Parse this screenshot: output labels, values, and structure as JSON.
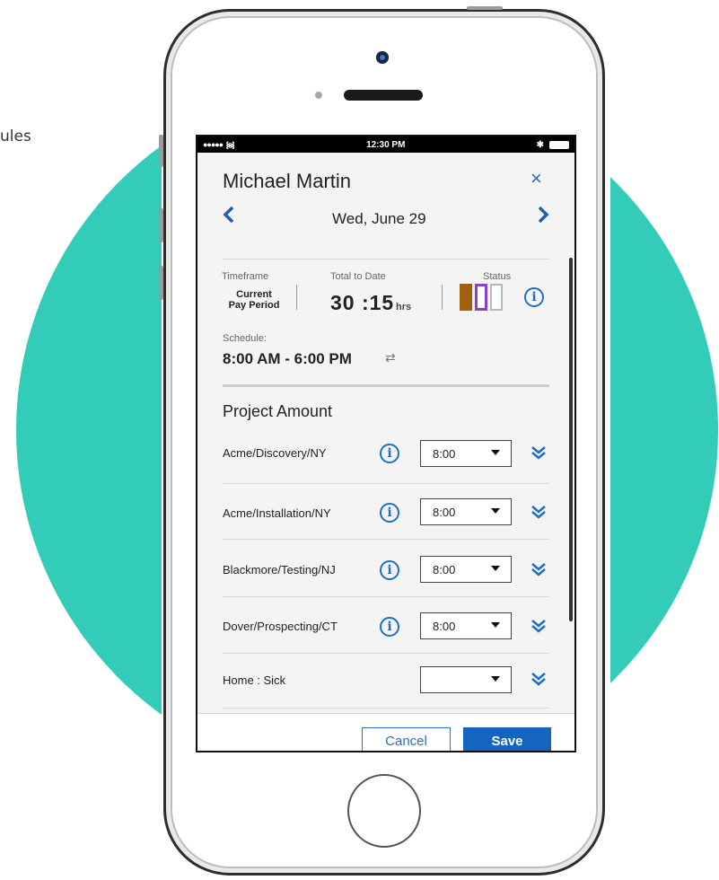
{
  "background_text": "ules",
  "statusbar": {
    "signal": "●●●●●",
    "wifi": "᯼",
    "time": "12:30 PM",
    "bluetooth": "✱"
  },
  "employee": {
    "name": "Michael Martin"
  },
  "nav": {
    "date": "Wed, June 29",
    "prev_icon": "‹",
    "next_icon": "›",
    "close_icon": "×"
  },
  "summary": {
    "timeframe_label": "Timeframe",
    "timeframe_value_line1": "Current",
    "timeframe_value_line2": "Pay Period",
    "total_label": "Total to Date",
    "total_value": "30 :15",
    "total_unit": "hrs",
    "status_label": "Status",
    "status_colors": [
      "#a0600d",
      "#8a3fd1",
      "#b8b8b8"
    ]
  },
  "schedule": {
    "label": "Schedule:",
    "value": "8:00 AM - 6:00 PM",
    "swap_icon": "⇄"
  },
  "projects": {
    "title": "Project Amount",
    "items": [
      {
        "name": "Acme/Discovery/NY",
        "amount": "8:00",
        "has_info": true
      },
      {
        "name": "Acme/Installation/NY",
        "amount": "8:00",
        "has_info": true
      },
      {
        "name": "Blackmore/Testing/NJ",
        "amount": "8:00",
        "has_info": true
      },
      {
        "name": "Dover/Prospecting/CT",
        "amount": "8:00",
        "has_info": true
      },
      {
        "name": "Home : Sick",
        "amount": "",
        "has_info": false
      }
    ]
  },
  "footer": {
    "cancel_label": "Cancel",
    "save_label": "Save"
  },
  "colors": {
    "accent": "#1565c0",
    "teal": "#33ccb9"
  }
}
